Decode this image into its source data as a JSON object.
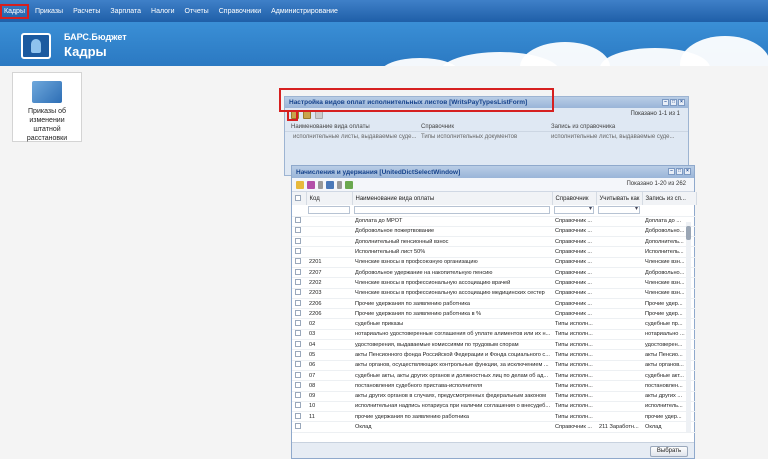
{
  "menu": [
    "Кадры",
    "Приказы",
    "Расчеты",
    "Зарплата",
    "Налоги",
    "Отчеты",
    "Справочники",
    "Администрирование"
  ],
  "brand": {
    "line1": "БАРС.Бюджет",
    "line2": "Кадры"
  },
  "tile": {
    "label": "Приказы об изменении штатной расстановки"
  },
  "win1": {
    "title": "Настройка видов оплат исполнительных листов [WritsPayTypesListForm]",
    "paging": "Показано 1-1 из 1",
    "columns": [
      "Наименование вида оплаты",
      "Справочник",
      "Запись из справочника"
    ],
    "row": [
      "исполнительные листы, выдаваемые суде...",
      "Типы исполнительных документов",
      "исполнительные листы, выдаваемые суде..."
    ]
  },
  "win2": {
    "title": "Начисления и удержания [UnitedDictSelectWindow]",
    "paging": "Показано 1-20 из 262",
    "columns": [
      "Код",
      "Наименование вида оплаты",
      "Справочник",
      "Учитывать как",
      "Запись из сп..."
    ],
    "rows": [
      [
        "",
        "Доплата до МРОТ",
        "Справочник ...",
        "",
        "Доплата до ..."
      ],
      [
        "",
        "Добровольное пожертвование",
        "Справочник ...",
        "",
        "Добровольно..."
      ],
      [
        "",
        "Дополнительный пенсионный взнос",
        "Справочник ...",
        "",
        "Дополнитель..."
      ],
      [
        "",
        "Исполнительный лист 50%",
        "Справочник ...",
        "",
        "Исполнитель..."
      ],
      [
        "2201",
        "Членские взносы в профсоюзную организацию",
        "Справочник ...",
        "",
        "Членские взн..."
      ],
      [
        "2207",
        "Добровольное удержание на накопительную пенсию",
        "Справочник ...",
        "",
        "Добровольно..."
      ],
      [
        "2202",
        "Членские взносы в профессиональную ассоциацию врачей",
        "Справочник ...",
        "",
        "Членские взн..."
      ],
      [
        "2203",
        "Членские взносы в профессиональную ассоциацию медицинских сестер",
        "Справочник ...",
        "",
        "Членские взн..."
      ],
      [
        "2206",
        "Прочие удержания по заявлению работника",
        "Справочник ...",
        "",
        "Прочие удер..."
      ],
      [
        "2206",
        "Прочие удержания по заявлению работника в %",
        "Справочник ...",
        "",
        "Прочие удер..."
      ],
      [
        "02",
        "судебные приказы",
        "Типы исполн...",
        "",
        "судебные пр..."
      ],
      [
        "03",
        "нотариально удостоверенные соглашения об уплате алиментов или их н...",
        "Типы исполн...",
        "",
        "нотариально ..."
      ],
      [
        "04",
        "удостоверения, выдаваемые комиссиями по трудовым спорам",
        "Типы исполн...",
        "",
        "удостоверен..."
      ],
      [
        "05",
        "акты Пенсионного фонда Российской Федерации и Фонда социального с...",
        "Типы исполн...",
        "",
        "акты Пенсио..."
      ],
      [
        "06",
        "акты органов, осуществляющих контрольные функции, за исключением ...",
        "Типы исполн...",
        "",
        "акты органов..."
      ],
      [
        "07",
        "судебные акты, акты других органов и должностных лиц по делам об ад...",
        "Типы исполн...",
        "",
        "судебные акт..."
      ],
      [
        "08",
        "постановления судебного пристава-исполнителя",
        "Типы исполн...",
        "",
        "постановлен..."
      ],
      [
        "09",
        "акты других органов в случаях, предусмотренных федеральным законом",
        "Типы исполн...",
        "",
        "акты других ..."
      ],
      [
        "10",
        "исполнительная надпись нотариуса при наличии соглашения о внесудеб...",
        "Типы исполн...",
        "",
        "исполнитель..."
      ],
      [
        "11",
        "прочие удержания по заявлению работника",
        "Типы исполн...",
        "",
        "прочие удер..."
      ],
      [
        "",
        "Оклад",
        "Справочник ...",
        "211 Заработн...",
        "Оклад"
      ]
    ],
    "select_label": "Выбрать"
  }
}
